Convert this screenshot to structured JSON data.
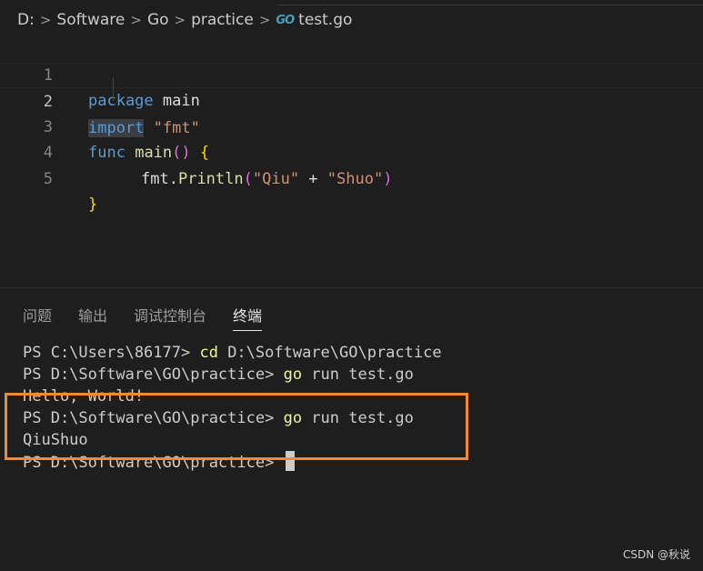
{
  "breadcrumb": {
    "parts": [
      "D:",
      "Software",
      "Go",
      "practice"
    ],
    "file_icon": "GO",
    "file": "test.go"
  },
  "editor": {
    "line_numbers": [
      "1",
      "2",
      "3",
      "4",
      "5"
    ],
    "line1": {
      "kw": "package",
      "id": "main"
    },
    "line2": {
      "kw": "import",
      "str": "\"fmt\""
    },
    "line3": {
      "kw": "func",
      "fn": "main",
      "parens": "()",
      "brace": "{"
    },
    "line4": {
      "pkg": "fmt",
      "dot": ".",
      "fn": "Println",
      "open": "(",
      "str1": "\"Qiu\"",
      "op": " + ",
      "str2": "\"Shuo\"",
      "close": ")"
    },
    "line5": {
      "brace": "}"
    }
  },
  "panel": {
    "tabs": [
      "问题",
      "输出",
      "调试控制台",
      "终端"
    ],
    "active_tab": "终端"
  },
  "terminal": {
    "lines": [
      {
        "prompt": "PS C:\\Users\\86177> ",
        "cmd": "cd",
        "rest": " D:\\Software\\GO\\practice"
      },
      {
        "prompt": "PS D:\\Software\\GO\\practice> ",
        "cmd": "go",
        "rest": " run test.go"
      },
      {
        "output": "Hello, World!"
      },
      {
        "prompt": "PS D:\\Software\\GO\\practice> ",
        "cmd": "go",
        "rest": " run test.go"
      },
      {
        "output": "QiuShuo"
      },
      {
        "prompt": "PS D:\\Software\\GO\\practice> "
      }
    ]
  },
  "watermark": "CSDN @秋说",
  "colors": {
    "highlight_box": "#f08a33",
    "keyword": "#569cd6",
    "string": "#ce9178",
    "function": "#dcdcaa",
    "terminal_command": "#f1fa8c"
  }
}
